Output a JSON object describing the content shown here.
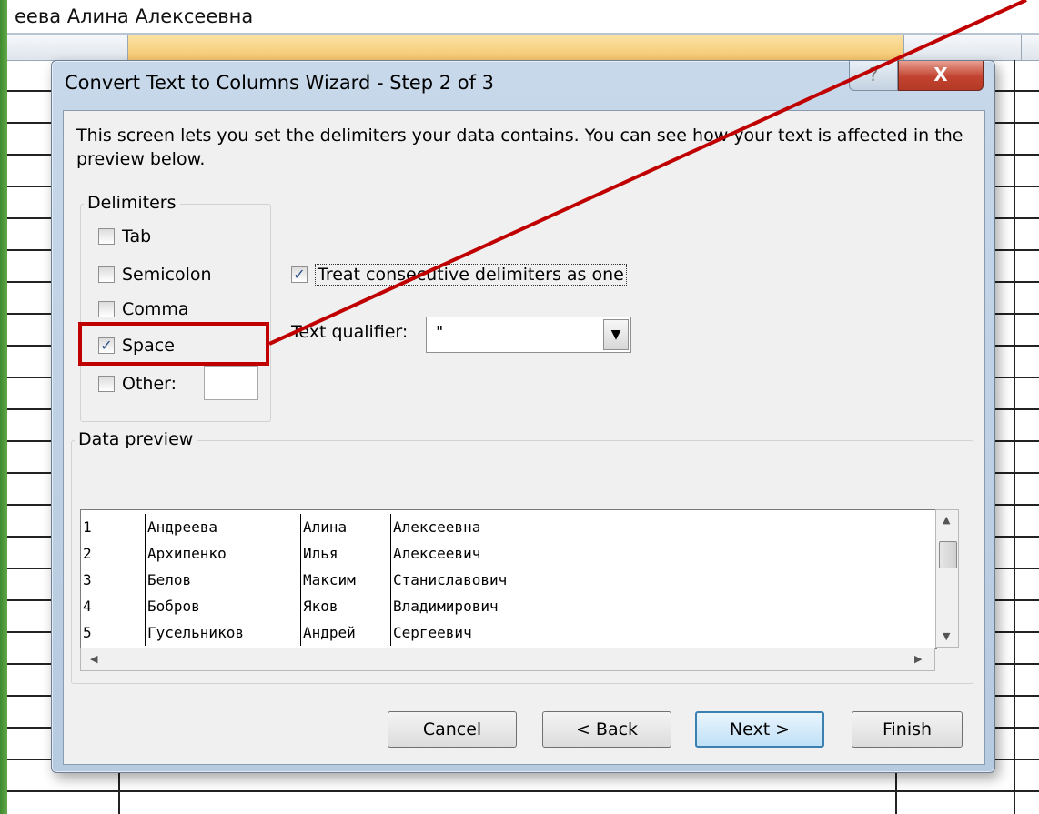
{
  "sheet": {
    "formula_bar_text": "еева Алина Алексеевна"
  },
  "dialog": {
    "title": "Convert Text to Columns Wizard - Step 2 of 3",
    "help_glyph": "?",
    "close_glyph": "X",
    "instruction": "This screen lets you set the delimiters your data contains.  You can see how your text is affected in the preview below.",
    "delimiters": {
      "group_label": "Delimiters",
      "items": [
        {
          "label": "Tab",
          "checked": false
        },
        {
          "label": "Semicolon",
          "checked": false
        },
        {
          "label": "Comma",
          "checked": false
        },
        {
          "label": "Space",
          "checked": true
        },
        {
          "label": "Other:",
          "checked": false
        }
      ],
      "other_value": ""
    },
    "treat_consecutive": {
      "label": "Treat consecutive delimiters as one",
      "checked": true
    },
    "text_qualifier": {
      "label": "Text qualifier:",
      "value": "\""
    },
    "data_preview": {
      "group_label": "Data preview",
      "rows": [
        [
          "1",
          "Андреева",
          "Алина",
          "Алексеевна"
        ],
        [
          "2",
          "Архипенко",
          "Илья",
          "Алексеевич"
        ],
        [
          "3",
          "Белов",
          "Максим",
          "Станиславович"
        ],
        [
          "4",
          "Бобров",
          "Яков",
          "Владимирович"
        ],
        [
          "5",
          "Гусельников",
          "Андрей",
          "Сергеевич"
        ]
      ]
    },
    "buttons": {
      "cancel": "Cancel",
      "back": "< Back",
      "next": "Next >",
      "finish": "Finish"
    }
  },
  "colors": {
    "annotation_red": "#c00000",
    "excel_green": "#3f8a2f"
  },
  "icons": [
    "help-icon",
    "close-icon",
    "checkmark-icon",
    "dropdown-arrow-icon",
    "scroll-up-icon",
    "scroll-down-icon",
    "scroll-left-icon",
    "scroll-right-icon"
  ]
}
